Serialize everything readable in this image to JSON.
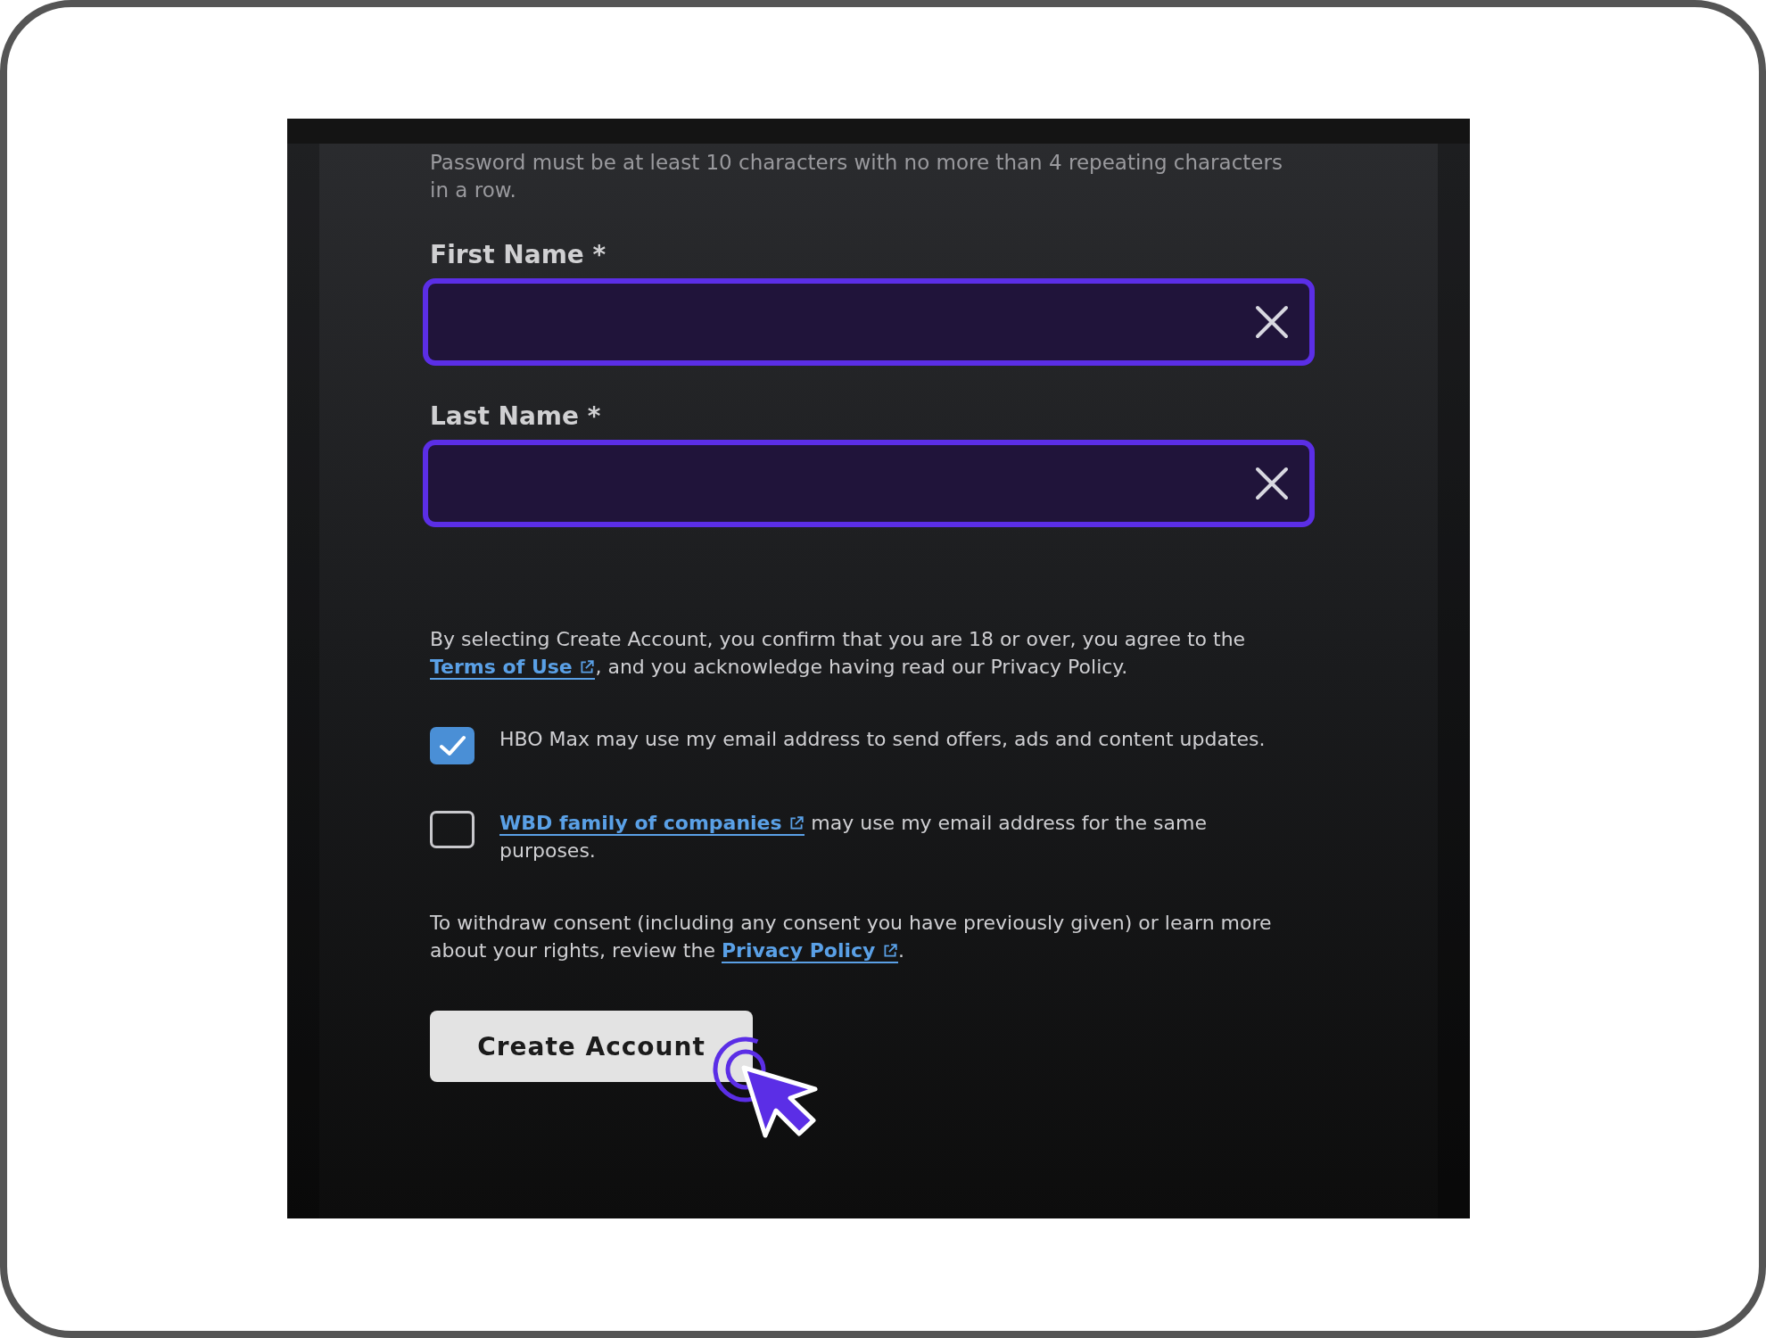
{
  "hint": "Password must be at least 10 characters with no more than 4 repeating characters in a row.",
  "fields": [
    {
      "label": "First Name *"
    },
    {
      "label": "Last Name *"
    }
  ],
  "agreement": {
    "before": "By selecting Create Account, you confirm that you are 18 or over, you agree to the ",
    "link": "Terms of Use",
    "after": ", and you acknowledge having read our Privacy Policy."
  },
  "consents": [
    {
      "checked": true,
      "text": "HBO Max may use my email address to send offers, ads and content updates."
    },
    {
      "checked": false,
      "link": "WBD family of companies",
      "text": " may use my email address for the same purposes."
    }
  ],
  "withdraw": {
    "before": "To withdraw consent (including any consent you have previously given) or learn more about your rights, review the ",
    "link": "Privacy Policy",
    "after": "."
  },
  "button": "Create Account"
}
